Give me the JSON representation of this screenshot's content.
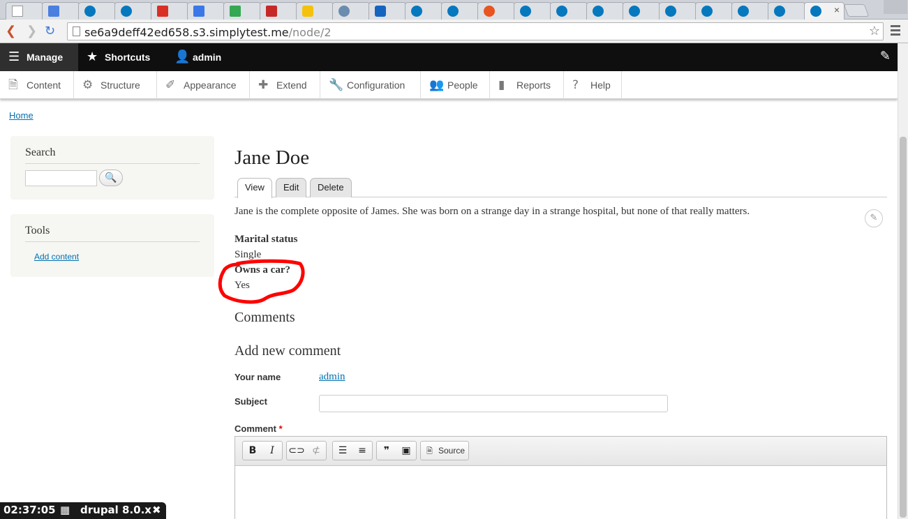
{
  "browser": {
    "url_host": "se6a9deff42ed658.s3.simplytest.me",
    "url_path": "/node/2"
  },
  "admin_toolbar": {
    "manage": "Manage",
    "shortcuts": "Shortcuts",
    "user": "admin"
  },
  "tray": {
    "items": [
      "Content",
      "Structure",
      "Appearance",
      "Extend",
      "Configuration",
      "People",
      "Reports",
      "Help"
    ]
  },
  "breadcrumb": {
    "home": "Home"
  },
  "sidebar": {
    "search_title": "Search",
    "tools_title": "Tools",
    "add_content": "Add content"
  },
  "node": {
    "title": "Jane Doe",
    "tabs": [
      "View",
      "Edit",
      "Delete"
    ],
    "body": "Jane is the complete opposite of James. She was born on a strange day in a strange hospital, but none of that really matters.",
    "fields": [
      {
        "label": "Marital status",
        "value": "Single"
      },
      {
        "label": "Owns a car?",
        "value": "Yes"
      }
    ]
  },
  "comments": {
    "heading": "Comments",
    "add_heading": "Add new comment",
    "your_name_label": "Your name",
    "your_name_value": "admin",
    "subject_label": "Subject",
    "comment_label": "Comment",
    "required_mark": "*",
    "source_button": "Source"
  },
  "overlay": {
    "time": "02:37:05",
    "label": "drupal 8.0.x",
    "close": "✖"
  },
  "colors": {
    "link": "#0071b3",
    "annotation": "#ff0000",
    "admin_bar": "#0f0f0f"
  }
}
